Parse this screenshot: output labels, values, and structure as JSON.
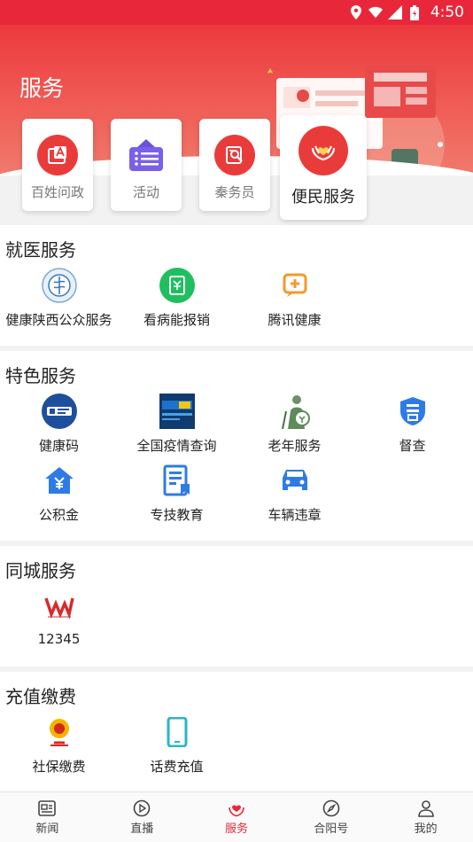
{
  "status_bar": {
    "time": "4:50"
  },
  "header": {
    "title": "服务"
  },
  "quick_cards": [
    {
      "label": "百姓问政",
      "icon": "document-a-icon"
    },
    {
      "label": "活动",
      "icon": "list-board-icon"
    },
    {
      "label": "秦务员",
      "icon": "search-doc-icon"
    },
    {
      "label": "便民服务",
      "icon": "heart-hands-icon"
    }
  ],
  "sections": {
    "medical": {
      "title": "就医服务",
      "items": [
        {
          "label": "健康陕西公众服务",
          "icon": "health-emblem-icon"
        },
        {
          "label": "看病能报销",
          "icon": "reimburse-icon"
        },
        {
          "label": "腾讯健康",
          "icon": "tencent-health-icon"
        }
      ]
    },
    "featured": {
      "title": "特色服务",
      "items": [
        {
          "label": "健康码",
          "icon": "health-code-icon"
        },
        {
          "label": "全国疫情查询",
          "icon": "epidemic-query-icon"
        },
        {
          "label": "老年服务",
          "icon": "elderly-icon"
        },
        {
          "label": "督查",
          "icon": "supervise-icon"
        },
        {
          "label": "公积金",
          "icon": "fund-icon"
        },
        {
          "label": "专技教育",
          "icon": "education-icon"
        },
        {
          "label": "车辆违章",
          "icon": "car-icon"
        }
      ]
    },
    "city": {
      "title": "同城服务",
      "items": [
        {
          "label": "12345",
          "icon": "hotline-logo-icon"
        }
      ]
    },
    "recharge": {
      "title": "充值缴费",
      "items": [
        {
          "label": "社保缴费",
          "icon": "tax-emblem-icon"
        },
        {
          "label": "话费充值",
          "icon": "phone-icon"
        }
      ]
    }
  },
  "bottom_nav": [
    {
      "label": "新闻",
      "icon": "news-icon"
    },
    {
      "label": "直播",
      "icon": "play-icon"
    },
    {
      "label": "服务",
      "icon": "service-heart-icon"
    },
    {
      "label": "合阳号",
      "icon": "compass-icon"
    },
    {
      "label": "我的",
      "icon": "user-icon"
    }
  ],
  "colors": {
    "primary": "#e8283a",
    "green": "#1fbf5f",
    "orange": "#f39a2b",
    "blue": "#2f7be6",
    "teal": "#2ab7c2"
  }
}
